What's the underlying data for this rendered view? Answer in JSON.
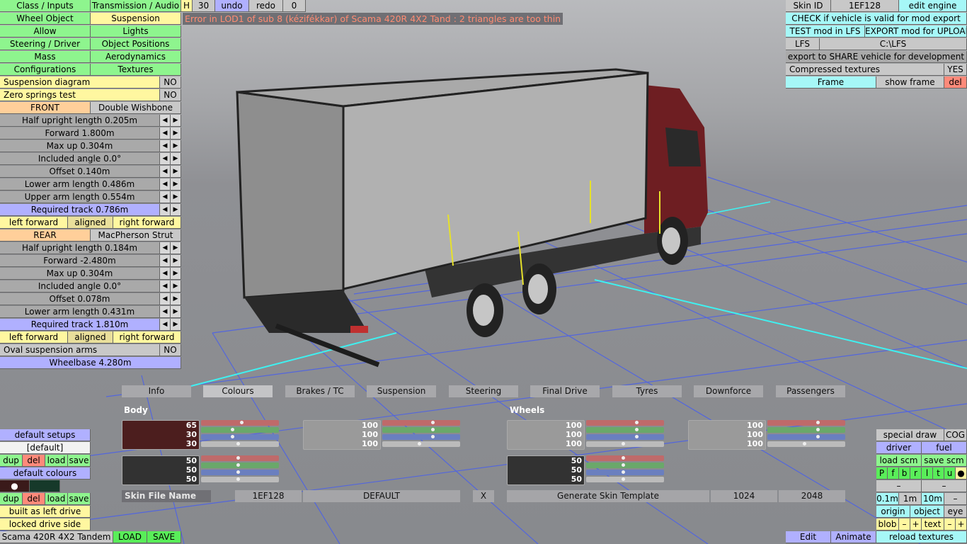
{
  "top": {
    "h": "H",
    "fps": "30",
    "undo": "undo",
    "redo": "redo",
    "zero": "0"
  },
  "error": "Error in LOD1 of sub 8 (kézifékkar) of Scama 420R 4X2 Tand : 2 triangles are too thin",
  "menu": {
    "class_inputs": "Class / Inputs",
    "transmission_audio": "Transmission / Audio",
    "wheel_object": "Wheel Object",
    "suspension": "Suspension",
    "allow": "Allow",
    "lights": "Lights",
    "steering_driver": "Steering / Driver",
    "object_positions": "Object Positions",
    "mass": "Mass",
    "aerodynamics": "Aerodynamics",
    "configurations": "Configurations",
    "textures": "Textures"
  },
  "susp": {
    "diagram": "Suspension diagram",
    "diagram_val": "NO",
    "zero_springs": "Zero springs test",
    "zero_val": "NO",
    "front": "FRONT",
    "front_type": "Double Wishbone",
    "front_params": [
      "Half upright length 0.205m",
      "Forward 1.800m",
      "Max up 0.304m",
      "Included angle 0.0°",
      "Offset 0.140m",
      "Lower arm length 0.486m",
      "Upper arm length 0.554m"
    ],
    "front_track": "Required track 0.786m",
    "rear": "REAR",
    "rear_type": "MacPherson Strut",
    "rear_params": [
      "Half upright length 0.184m",
      "Forward -2.480m",
      "Max up 0.304m",
      "Included angle 0.0°",
      "Offset 0.078m",
      "Lower arm length 0.431m"
    ],
    "rear_track": "Required track 1.810m",
    "left_forward": "left forward",
    "aligned": "aligned",
    "right_forward": "right forward",
    "oval": "Oval suspension arms",
    "oval_val": "NO",
    "wheelbase": "Wheelbase 4.280m"
  },
  "right": {
    "skin_id": "Skin ID",
    "skin_val": "1EF128",
    "edit_engine": "edit engine",
    "check": "CHECK if vehicle is valid for mod export",
    "test": "TEST mod in LFS",
    "export": "EXPORT mod for UPLOAD",
    "lfs": "LFS",
    "path": "C:\\LFS",
    "share": "export to SHARE vehicle for development",
    "compressed": "Compressed textures",
    "compressed_val": "YES",
    "frame": "Frame",
    "show_frame": "show frame",
    "del": "del"
  },
  "tabs": [
    "Info",
    "Colours",
    "Brakes / TC",
    "Suspension",
    "Steering",
    "Final Drive",
    "Tyres",
    "Downforce",
    "Passengers"
  ],
  "colours": {
    "body": "Body",
    "wheels": "Wheels",
    "body1": [
      "65",
      "30",
      "30"
    ],
    "body2": [
      "100",
      "100",
      "100"
    ],
    "body3": [
      "50",
      "50",
      "50"
    ],
    "wheel1": [
      "100",
      "100",
      "100"
    ],
    "wheel2": [
      "100",
      "100",
      "100"
    ],
    "wheel3": [
      "50",
      "50",
      "50"
    ],
    "swatch_body": "#4c1e1e",
    "swatch_dark": "#323232",
    "swatch_light": "#9a9a9a",
    "skin_file": "Skin File Name",
    "skin_file_val": "1EF128",
    "default": "DEFAULT",
    "x": "X",
    "generate": "Generate Skin Template",
    "res1": "1024",
    "res2": "2048"
  },
  "leftbottom": {
    "default_setups": "default setups",
    "default_sel": "[default]",
    "dup": "dup",
    "del": "del",
    "load": "load",
    "save": "save",
    "default_colours": "default colours",
    "dot": "●",
    "built_left": "built as left drive",
    "locked": "locked drive side"
  },
  "status": {
    "vehicle": "Scama 420R 4X2 Tandem",
    "load": "LOAD",
    "save": "SAVE",
    "edit": "Edit",
    "animate": "Animate",
    "reload": "reload textures"
  },
  "rightbottom": {
    "special": "special draw",
    "cog": "COG",
    "driver": "driver",
    "fuel": "fuel",
    "load_scm": "load scm",
    "save_scm": "save scm",
    "letters": [
      "P",
      "f",
      "b",
      "r",
      "l",
      "t",
      "u",
      "●"
    ],
    "minus": "–",
    "m01": "0.1m",
    "m1": "1m",
    "m10": "10m",
    "origin": "origin",
    "object": "object",
    "eye": "eye",
    "blob": "blob",
    "plus": "+",
    "text": "text"
  }
}
